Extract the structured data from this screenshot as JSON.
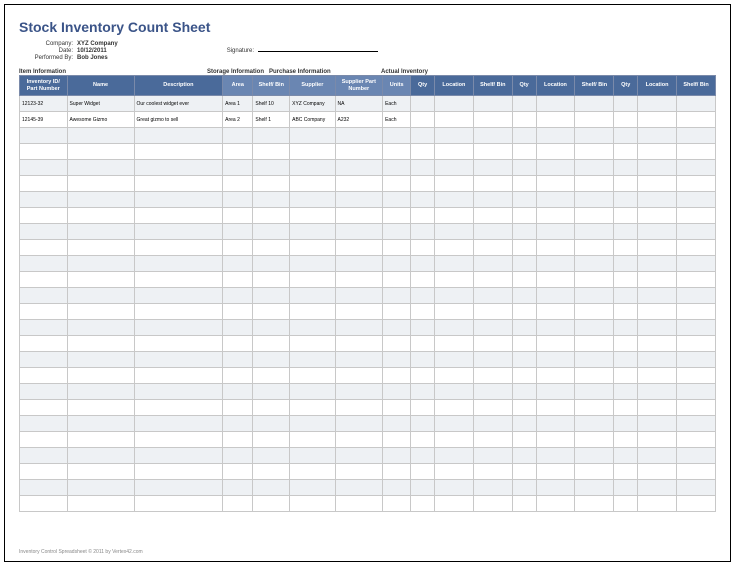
{
  "title": "Stock Inventory Count Sheet",
  "meta": {
    "company_label": "Company:",
    "company_value": "XYZ Company",
    "date_label": "Date:",
    "date_value": "10/12/2011",
    "performed_label": "Performed By:",
    "performed_value": "Bob Jones",
    "signature_label": "Signature:"
  },
  "sections": {
    "item": "Item Information",
    "storage": "Storage Information",
    "purchase": "Purchase Information",
    "actual": "Actual Inventory"
  },
  "headers": {
    "inv_id": "Inventory ID/ Part Number",
    "name": "Name",
    "desc": "Description",
    "area": "Area",
    "shelf": "Shelf/ Bin",
    "supplier": "Supplier",
    "sup_part": "Supplier Part Number",
    "units": "Units",
    "qty": "Qty",
    "location": "Location",
    "shelfbin": "Shelf/ Bin"
  },
  "rows": [
    {
      "id": "12123-32",
      "name": "Super Widget",
      "desc": "Our coolest widget ever",
      "area": "Area 1",
      "shelf": "Shelf 10",
      "supplier": "XYZ Company",
      "sup_part": "NA",
      "units": "Each"
    },
    {
      "id": "12145-39",
      "name": "Awesome Gizmo",
      "desc": "Great gizmo to sell",
      "area": "Area 2",
      "shelf": "Shelf 1",
      "supplier": "ABC Company",
      "sup_part": "A232",
      "units": "Each"
    }
  ],
  "empty_rows": 24,
  "footer": "Inventory Control Spreadsheet © 2011 by Vertex42.com"
}
